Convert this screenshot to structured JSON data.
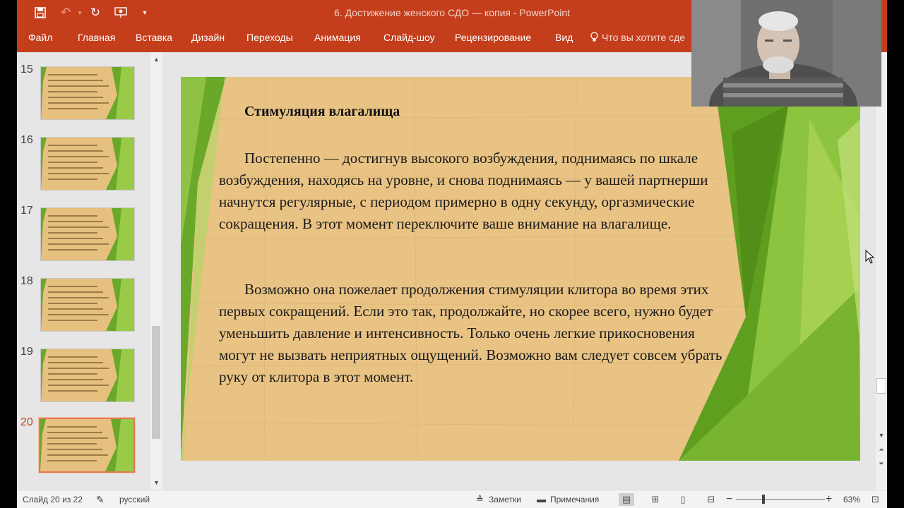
{
  "titlebar": {
    "title": "6. Достижение  женского СДО — копия - PowerPoint",
    "save_icon": "save-icon",
    "undo_icon": "undo-icon",
    "redo_icon": "redo-icon",
    "present_icon": "present-from-start-icon",
    "customize_icon": "customize-quick-access-icon"
  },
  "ribbon": {
    "tabs": [
      "Файл",
      "Главная",
      "Вставка",
      "Дизайн",
      "Переходы",
      "Анимация",
      "Слайд-шоу",
      "Рецензирование",
      "Вид"
    ],
    "tell_me": "Что вы хотите сде"
  },
  "thumbnails": {
    "items": [
      {
        "number": "15",
        "active": false
      },
      {
        "number": "16",
        "active": false
      },
      {
        "number": "17",
        "active": false
      },
      {
        "number": "18",
        "active": false
      },
      {
        "number": "19",
        "active": false
      },
      {
        "number": "20",
        "active": true
      }
    ]
  },
  "slide": {
    "heading": "Стимуляция влагалища",
    "paragraph1": "Постепенно — достигнув высокого возбуждения, поднимаясь по шкале возбуждения, находясь на уровне, и снова поднимаясь — у вашей партнерши начнутся регулярные, с периодом примерно в одну секунду, оргазмические сокращения. В этот момент переключите ваше внимание на влагалище.",
    "paragraph2": "Возможно она пожелает продолжения стимуляции клитора во время этих первых сокращений. Если это так, продолжайте, но скорее всего, нужно будет уменьшить давление и интенсивность. Только очень легкие прикосновения могут не вызвать неприятных ощущений. Возможно вам следует совсем убрать руку от клитора в этот момент.",
    "colors": {
      "parchment": "#e9c384",
      "green_dark": "#5f9f1f",
      "green_light": "#a6d04f"
    }
  },
  "status": {
    "slide_info": "Слайд 20 из 22",
    "language": "русский",
    "notes": "Заметки",
    "comments": "Примечания",
    "zoom_level": "63%",
    "zoom_fraction": 0.63
  },
  "theme": {
    "accent": "#c43e1c"
  }
}
